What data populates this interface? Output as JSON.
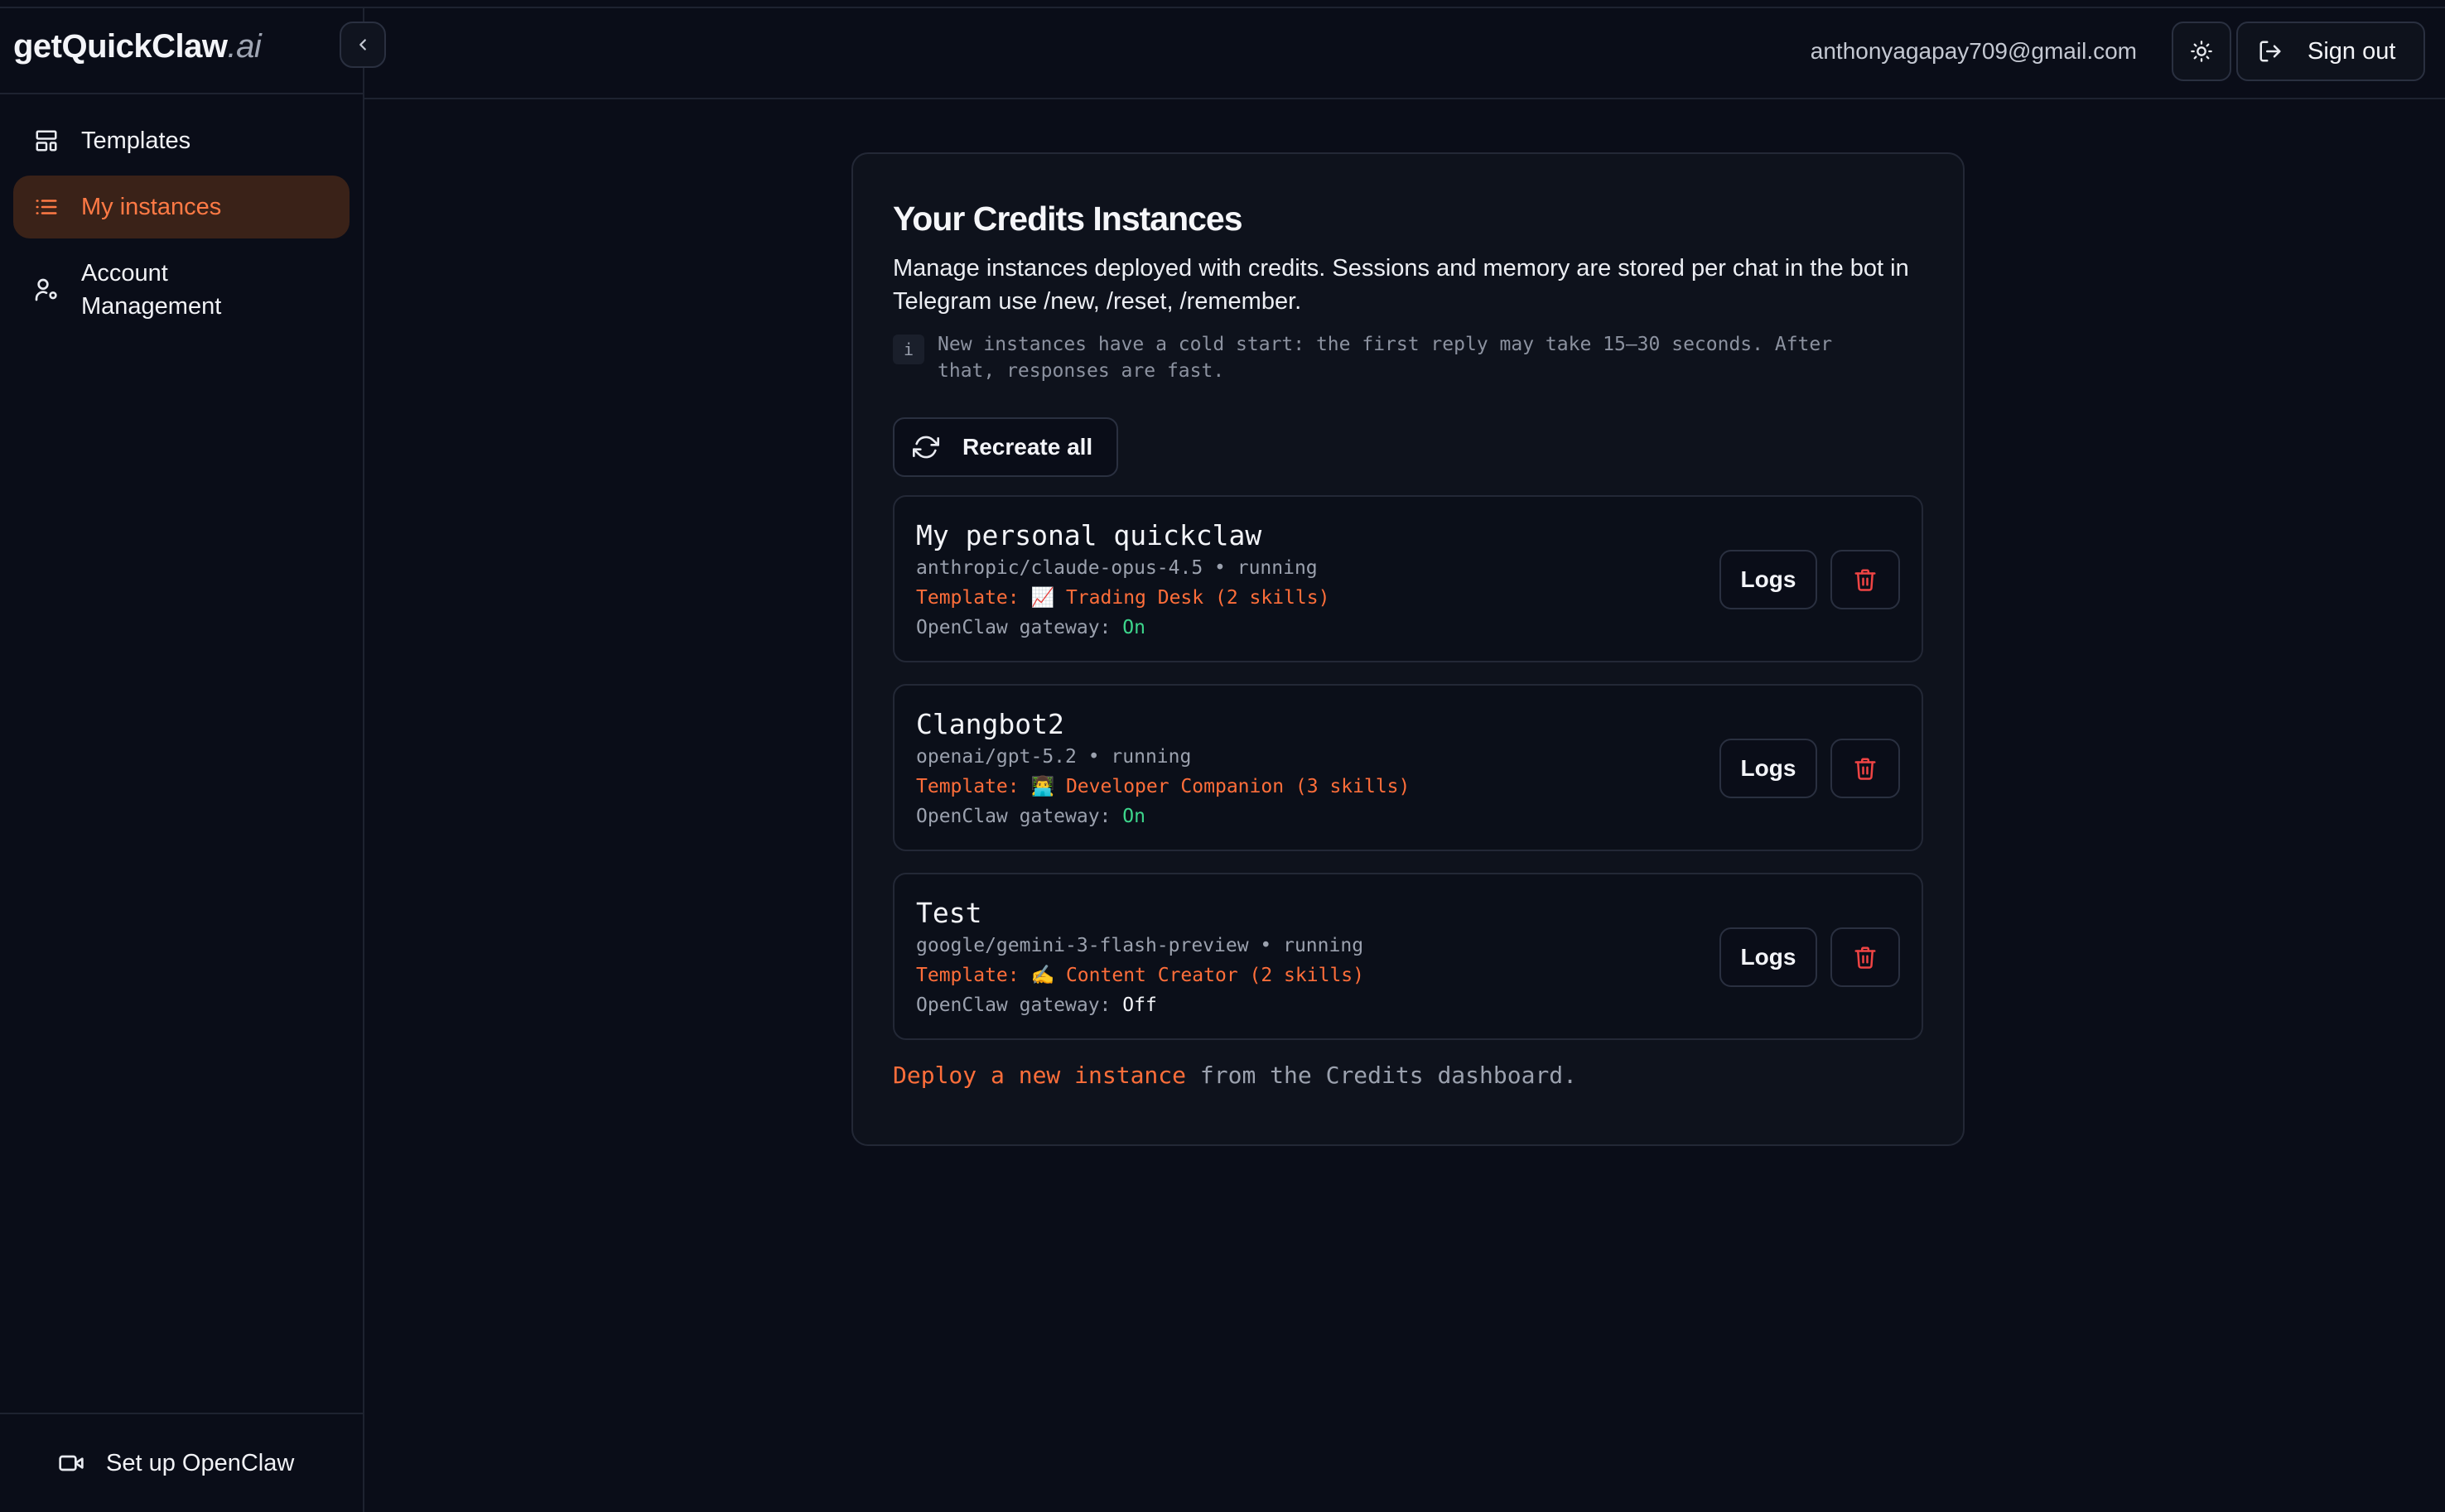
{
  "brand": {
    "name": "getQuickClaw",
    "suffix": ".ai"
  },
  "sidebar": {
    "items": [
      {
        "label": "Templates",
        "icon": "layout-template-icon",
        "active": false
      },
      {
        "label": "My instances",
        "icon": "list-icon",
        "active": true
      },
      {
        "label_line1": "Account",
        "label_line2": "Management",
        "icon": "user-cog-icon",
        "active": false
      }
    ],
    "footer": {
      "label": "Set up OpenClaw",
      "icon": "video-icon"
    }
  },
  "header": {
    "email": "anthonyagapay709@gmail.com",
    "theme_icon": "sun-icon",
    "signout_label": "Sign out"
  },
  "main": {
    "title": "Your Credits Instances",
    "description": "Manage instances deployed with credits. Sessions and memory are stored per chat in the bot in Telegram use /new, /reset, /remember.",
    "note_icon": "i",
    "note": "New instances have a cold start: the first reply may take 15–30 seconds. After that, responses are fast.",
    "recreate_label": "Recreate all",
    "instances": [
      {
        "name": "My personal quickclaw",
        "meta": "anthropic/claude-opus-4.5 • running",
        "template": "Template: 📈 Trading Desk (2 skills)",
        "gateway_label": "OpenClaw gateway: ",
        "gateway_status": "On",
        "logs_label": "Logs"
      },
      {
        "name": "Clangbot2",
        "meta": "openai/gpt-5.2 • running",
        "template": "Template: 👨‍💻 Developer Companion (3 skills)",
        "gateway_label": "OpenClaw gateway: ",
        "gateway_status": "On",
        "logs_label": "Logs"
      },
      {
        "name": "Test",
        "meta": "google/gemini-3-flash-preview • running",
        "template": "Template: ✍️ Content Creator (2 skills)",
        "gateway_label": "OpenClaw gateway: ",
        "gateway_status": "Off",
        "logs_label": "Logs"
      }
    ],
    "footer_link": "Deploy a new instance",
    "footer_text": " from the Credits dashboard."
  },
  "colors": {
    "accent": "#ff6e3a",
    "status_on": "#3dd68c",
    "danger": "#ef4444",
    "background": "#0a0d18"
  }
}
